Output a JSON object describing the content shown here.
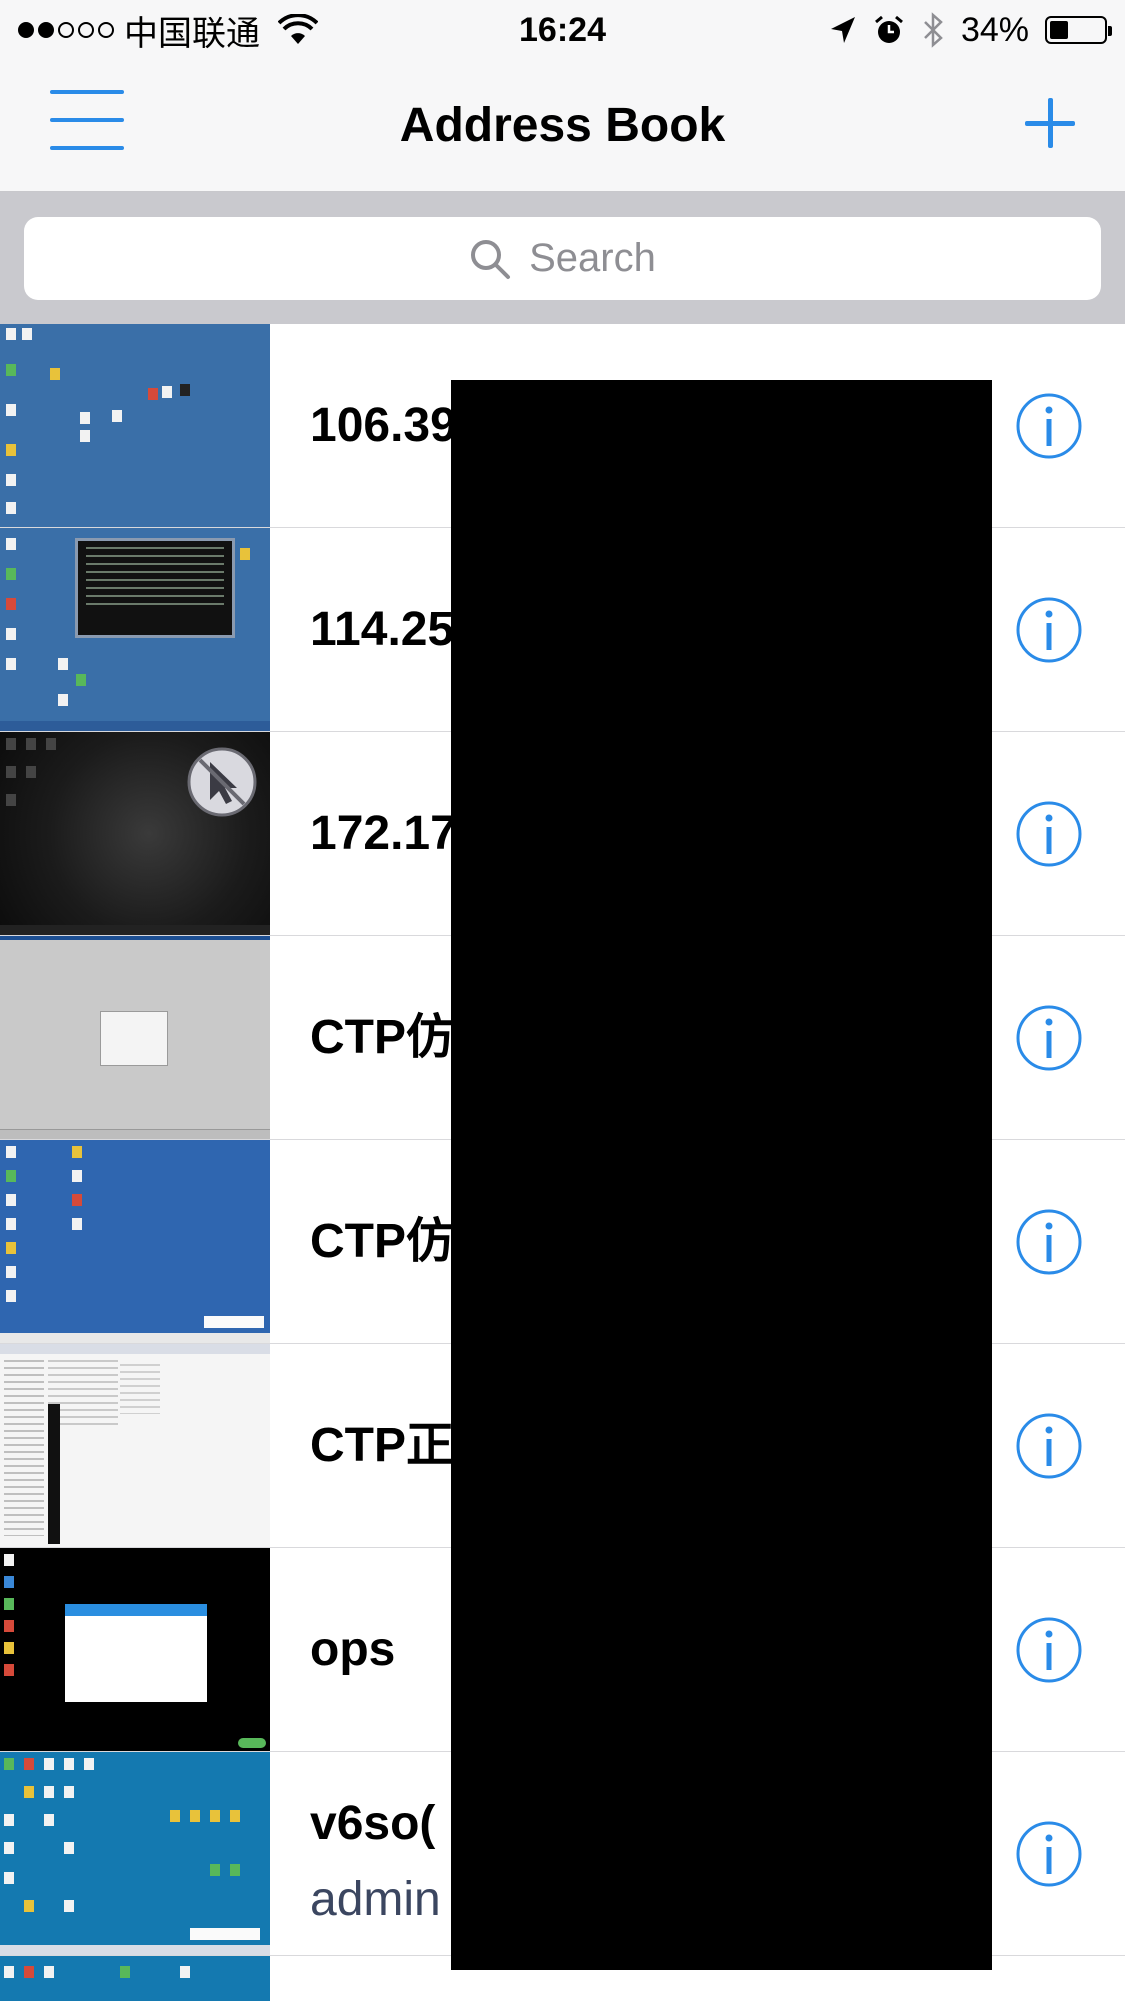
{
  "status_bar": {
    "carrier": "中国联通",
    "time": "16:24",
    "battery": "34%",
    "battery_level": 0.34,
    "signal_bars_filled": 2,
    "signal_bars_total": 5
  },
  "nav": {
    "title": "Address Book"
  },
  "search": {
    "placeholder": "Search"
  },
  "contacts": [
    {
      "title": "106.39",
      "thumbnail": "blue-desktop"
    },
    {
      "title": "114.25",
      "thumbnail": "blue-desktop-terminal"
    },
    {
      "title": "172.17",
      "thumbnail": "dark-desktop-no-cursor"
    },
    {
      "title": "CTP仿",
      "thumbnail": "gray-desktop-dialog"
    },
    {
      "title": "CTP仿",
      "thumbnail": "blue-desktop"
    },
    {
      "title": "CTP正",
      "thumbnail": "white-spreadsheet"
    },
    {
      "title": "ops",
      "thumbnail": "black-desktop-app-window"
    },
    {
      "title": "v6so(",
      "subtitle": "admin",
      "thumbnail": "teal-desktop-icons"
    }
  ],
  "colors": {
    "accent": "#2a8be8",
    "nav_background": "#f7f7f8",
    "search_background": "#c9c9ce",
    "redaction": "#000000"
  }
}
